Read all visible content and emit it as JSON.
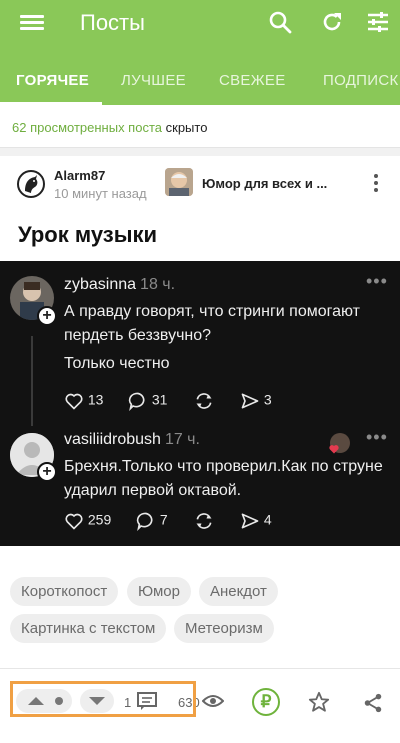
{
  "appbar": {
    "title": "Посты",
    "icons": [
      "menu-icon",
      "search-icon",
      "refresh-icon",
      "filter-icon"
    ]
  },
  "tabs": [
    {
      "label": "ГОРЯЧЕЕ",
      "active": true
    },
    {
      "label": "ЛУЧШЕЕ",
      "active": false
    },
    {
      "label": "СВЕЖЕЕ",
      "active": false
    },
    {
      "label": "ПОДПИСК",
      "active": false
    }
  ],
  "hidden_notice": {
    "link": "62 просмотренных поста",
    "text": "скрыто"
  },
  "post": {
    "author": "Alarm87",
    "time": "10 минут назад",
    "community": "Юмор для всех и ...",
    "title": "Урок музыки",
    "comments": [
      {
        "user": "zybasinna",
        "ago": "18 ч.",
        "text1": "А правду говорят, что стринги помогают пердеть беззвучно?",
        "text2": "Только честно",
        "likes": "13",
        "replies": "31",
        "shares": "3"
      },
      {
        "user": "vasiliidrobush",
        "ago": "17 ч.",
        "text1": "Брехня.Только что проверил.Как по струне ударил первой октавой.",
        "likes": "259",
        "replies": "7",
        "shares": "4"
      }
    ],
    "tags": [
      "Короткопост",
      "Юмор",
      "Анекдот",
      "Картинка с текстом",
      "Метеоризм"
    ]
  },
  "bottom": {
    "comments_count": "1",
    "views": "630",
    "donate_symbol": "₽"
  },
  "colors": {
    "accent": "#8ac858",
    "link": "#6fae3f",
    "highlight": "#f0a044"
  }
}
